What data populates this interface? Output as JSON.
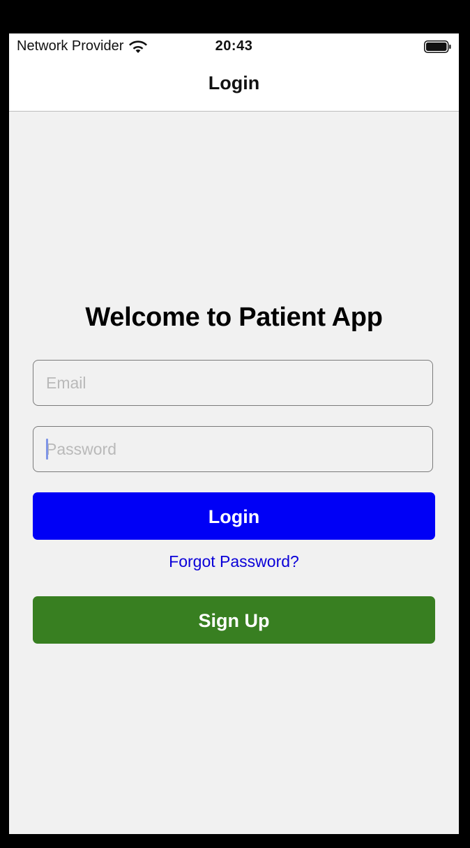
{
  "status_bar": {
    "carrier": "Network Provider",
    "time": "20:43",
    "icons": [
      "wifi-icon",
      "battery-icon"
    ]
  },
  "nav": {
    "title": "Login"
  },
  "main": {
    "welcome": "Welcome to Patient App",
    "email": {
      "placeholder": "Email",
      "value": ""
    },
    "password": {
      "placeholder": "Password",
      "value": ""
    },
    "login_label": "Login",
    "forgot_label": "Forgot Password?",
    "signup_label": "Sign Up"
  },
  "colors": {
    "login_button": "#0000f6",
    "signup_button": "#387f21",
    "link": "#0a00d8",
    "background": "#f1f1f1"
  }
}
